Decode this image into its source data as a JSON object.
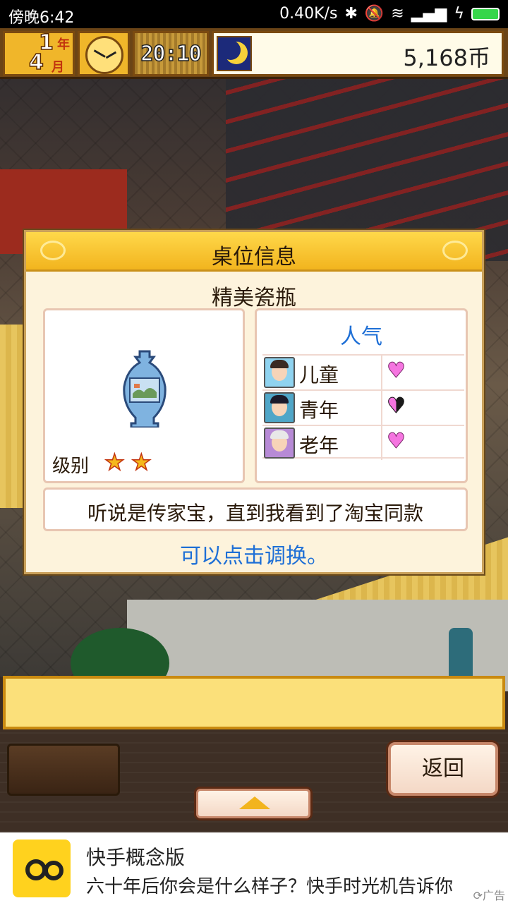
{
  "status_bar": {
    "time": "傍晚6:42",
    "network_speed": "0.40K/s"
  },
  "hud": {
    "year_num": "1",
    "year_unit": "年",
    "month_num": "4",
    "month_unit": "月",
    "clock_time": "20:10",
    "money": "5,168币"
  },
  "dialog": {
    "title": "桌位信息",
    "item_name": "精美瓷瓶",
    "rank_label": "级别",
    "rank_stars": 2,
    "popularity_title": "人气",
    "popularity": [
      {
        "label": "儿童",
        "hearts": 1.0
      },
      {
        "label": "青年",
        "hearts": 0.5
      },
      {
        "label": "老年",
        "hearts": 1.0
      }
    ],
    "description": "听说是传家宝，直到我看到了淘宝同款",
    "hint": "可以点击调换。"
  },
  "bottom": {
    "back_label": "返回"
  },
  "ad": {
    "title": "快手概念版",
    "desc": "六十年后你会是什么样子？快手时光机告诉你",
    "tag": "广告"
  },
  "colors": {
    "accent_blue": "#1e6fd6",
    "header_gold": "#f2b41e",
    "heart_pink": "#f575e0"
  }
}
